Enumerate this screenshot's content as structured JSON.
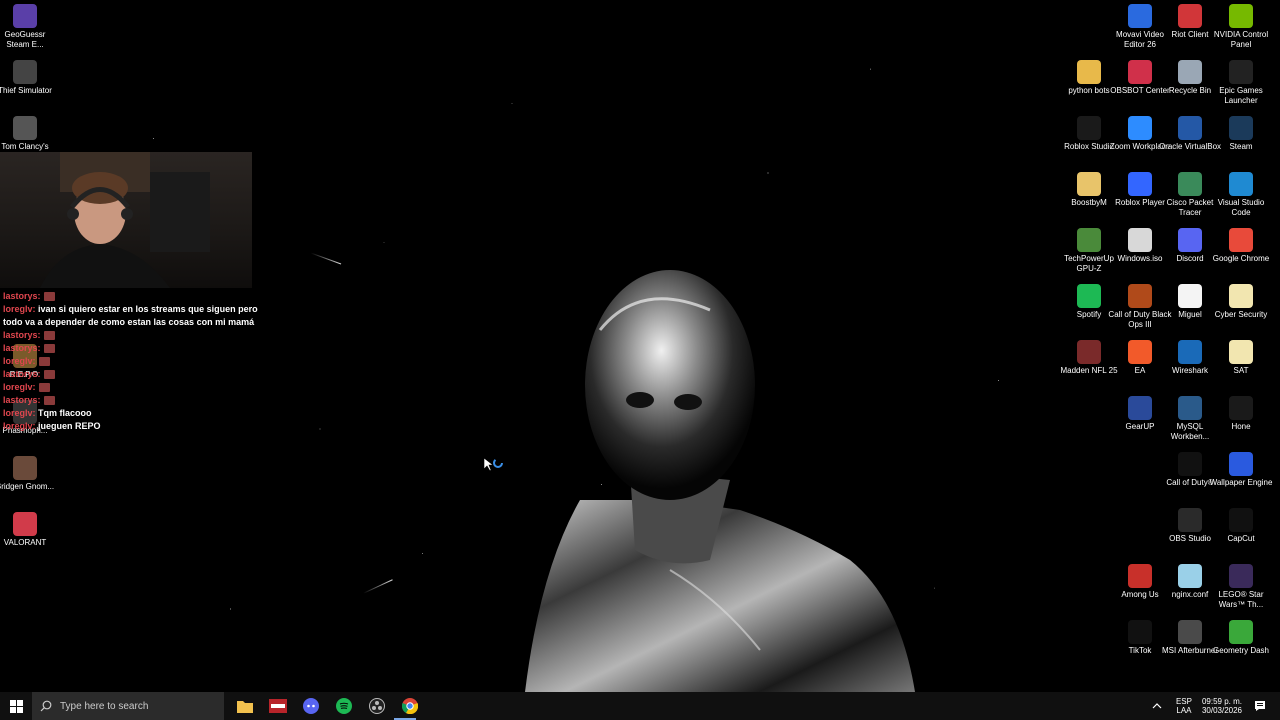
{
  "left_icons": [
    {
      "label": "GeoGuessr Steam E...",
      "icon": "geoguessr-icon",
      "color": "#5a3fa8"
    },
    {
      "label": "Thief Simulator",
      "icon": "thief-simulator-icon",
      "color": "#444444"
    },
    {
      "label": "Tom Clancy's",
      "icon": "tom-clancys-icon",
      "color": "#555555"
    },
    {
      "label": "R.E.P.O.",
      "icon": "repo-icon",
      "color": "#7a5a2a"
    },
    {
      "label": "Phasmoph...",
      "icon": "phasmophobia-icon",
      "color": "#333333"
    },
    {
      "label": "Bridgen Gnom...",
      "icon": "bridge-game-icon",
      "color": "#6a4a3a"
    },
    {
      "label": "VALORANT",
      "icon": "valorant-icon",
      "color": "#d13b4a"
    }
  ],
  "right_icons": [
    {
      "label": "Movavi Video Editor 26",
      "icon": "movavi-icon",
      "color": "#2a6adf"
    },
    {
      "label": "Riot Client",
      "icon": "riot-client-icon",
      "color": "#d13639"
    },
    {
      "label": "NVIDIA Control Panel",
      "icon": "nvidia-icon",
      "color": "#76b900"
    },
    {
      "label": "python bots",
      "icon": "folder-icon",
      "color": "#e8b94a"
    },
    {
      "label": "OBSBOT Center",
      "icon": "obsbot-icon",
      "color": "#d0304a"
    },
    {
      "label": "Recycle Bin",
      "icon": "recycle-bin-icon",
      "color": "#9aa7b5"
    },
    {
      "label": "Epic Games Launcher",
      "icon": "epic-games-icon",
      "color": "#222222"
    },
    {
      "label": "Roblox Studio",
      "icon": "roblox-studio-icon",
      "color": "#1a1a1a"
    },
    {
      "label": "Zoom Workplace",
      "icon": "zoom-icon",
      "color": "#2d8cff"
    },
    {
      "label": "Oracle VirtualBox",
      "icon": "virtualbox-icon",
      "color": "#2458a6"
    },
    {
      "label": "Steam",
      "icon": "steam-icon",
      "color": "#1b3a5a"
    },
    {
      "label": "BoostbyM",
      "icon": "folder-icon",
      "color": "#e8c46a"
    },
    {
      "label": "Roblox Player",
      "icon": "roblox-player-icon",
      "color": "#3366ff"
    },
    {
      "label": "Cisco Packet Tracer",
      "icon": "cisco-icon",
      "color": "#3a8a5a"
    },
    {
      "label": "Visual Studio Code",
      "icon": "vscode-icon",
      "color": "#1f8ad2"
    },
    {
      "label": "TechPowerUp GPU-Z",
      "icon": "gpuz-icon",
      "color": "#4a8a3a"
    },
    {
      "label": "Windows.iso",
      "icon": "disc-file-icon",
      "color": "#d8d8d8"
    },
    {
      "label": "Discord",
      "icon": "discord-icon",
      "color": "#5865f2"
    },
    {
      "label": "Google Chrome",
      "icon": "chrome-icon",
      "color": "#e84a3a"
    },
    {
      "label": "Spotify",
      "icon": "spotify-icon",
      "color": "#1db954"
    },
    {
      "label": "Call of Duty Black Ops III",
      "icon": "cod-bo3-icon",
      "color": "#b04a1a"
    },
    {
      "label": "Miguel",
      "icon": "pdf-file-icon",
      "color": "#f4f4f4"
    },
    {
      "label": "Cyber Security",
      "icon": "file-icon",
      "color": "#f2e6b0"
    },
    {
      "label": "Madden NFL 25",
      "icon": "madden-icon",
      "color": "#7a2a2a"
    },
    {
      "label": "EA",
      "icon": "ea-icon",
      "color": "#f25a2a"
    },
    {
      "label": "Wireshark",
      "icon": "wireshark-icon",
      "color": "#1a6ab8"
    },
    {
      "label": "SAT",
      "icon": "file-icon",
      "color": "#f2e6b0"
    },
    {
      "label": "GearUP",
      "icon": "gearup-icon",
      "color": "#2a4a9a"
    },
    {
      "label": "MySQL Workben...",
      "icon": "mysql-icon",
      "color": "#2a5a8a"
    },
    {
      "label": "Hone",
      "icon": "hone-icon",
      "color": "#1a1a1a"
    },
    {
      "label": "Call of Duty®",
      "icon": "cod-icon",
      "color": "#111111"
    },
    {
      "label": "Wallpaper Engine",
      "icon": "wallpaper-engine-icon",
      "color": "#2a5adf"
    },
    {
      "label": "OBS Studio",
      "icon": "obs-icon",
      "color": "#2a2a2a"
    },
    {
      "label": "CapCut",
      "icon": "capcut-icon",
      "color": "#111111"
    },
    {
      "label": "Among Us",
      "icon": "among-us-icon",
      "color": "#c8302a"
    },
    {
      "label": "nginx.conf",
      "icon": "conf-file-icon",
      "color": "#9ad0e8"
    },
    {
      "label": "LEGO® Star Wars™ Th...",
      "icon": "lego-starwars-icon",
      "color": "#3a2a5a"
    },
    {
      "label": "TikTok",
      "icon": "tiktok-icon",
      "color": "#111111"
    },
    {
      "label": "MSI Afterburner",
      "icon": "msi-afterburner-icon",
      "color": "#4a4a4a"
    },
    {
      "label": "Geometry Dash",
      "icon": "geometry-dash-icon",
      "color": "#3aa83a"
    }
  ],
  "chat": [
    {
      "user": "lastorys:",
      "msg": ""
    },
    {
      "user": "loreglv:",
      "msg": "ivan si quiero estar en los streams que siguen pero todo va a depender de como estan las cosas con mi mamá"
    },
    {
      "user": "lastorys:",
      "msg": ""
    },
    {
      "user": "lastorys:",
      "msg": ""
    },
    {
      "user": "loreglv:",
      "msg": ""
    },
    {
      "user": "lastorys:",
      "msg": ""
    },
    {
      "user": "loreglv:",
      "msg": ""
    },
    {
      "user": "lastorys:",
      "msg": ""
    },
    {
      "user": "loreglv:",
      "msg": "Tqm flacooo"
    },
    {
      "user": "loreglv:",
      "msg": "jueguen REPO"
    }
  ],
  "taskbar": {
    "search_placeholder": "Type here to search",
    "apps": [
      "file-explorer-icon",
      "voicemeeter-icon",
      "discord-icon",
      "spotify-icon",
      "obs-icon",
      "chrome-icon"
    ],
    "lang_line1": "ESP",
    "lang_line2": "LAA",
    "time": "09:59 p. m.",
    "date": "30/03/2026"
  }
}
